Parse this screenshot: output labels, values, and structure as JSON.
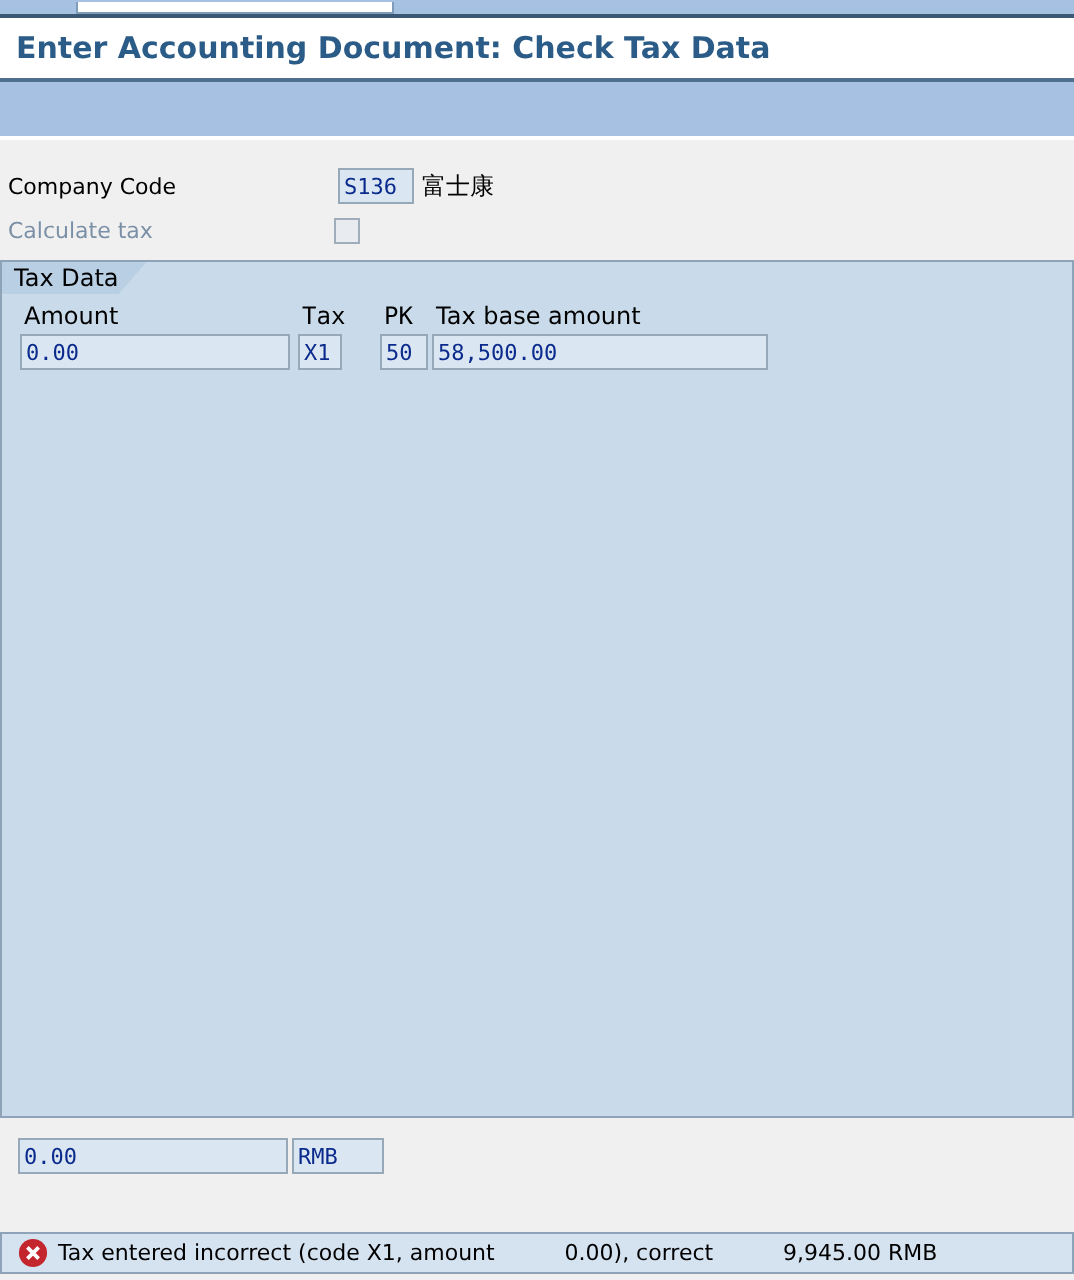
{
  "window": {
    "title": "Enter Accounting Document: Check Tax Data"
  },
  "company_code": {
    "label": "Company Code",
    "value": "S136",
    "name": "富士康"
  },
  "calculate_tax": {
    "label": "Calculate tax",
    "checked": false,
    "disabled": true
  },
  "tax_data": {
    "tab": "Tax Data",
    "columns": [
      "Amount",
      "Tax",
      "PK",
      "Tax base amount"
    ],
    "rows": [
      [
        "0.00",
        "X1",
        "50",
        "58,500.00"
      ]
    ]
  },
  "totals": {
    "amount": "0.00",
    "currency": "RMB"
  },
  "status_bar": {
    "kind": "error",
    "message": "Tax entered incorrect (code X1, amount          0.00), correct          9,945.00 RMB"
  }
}
